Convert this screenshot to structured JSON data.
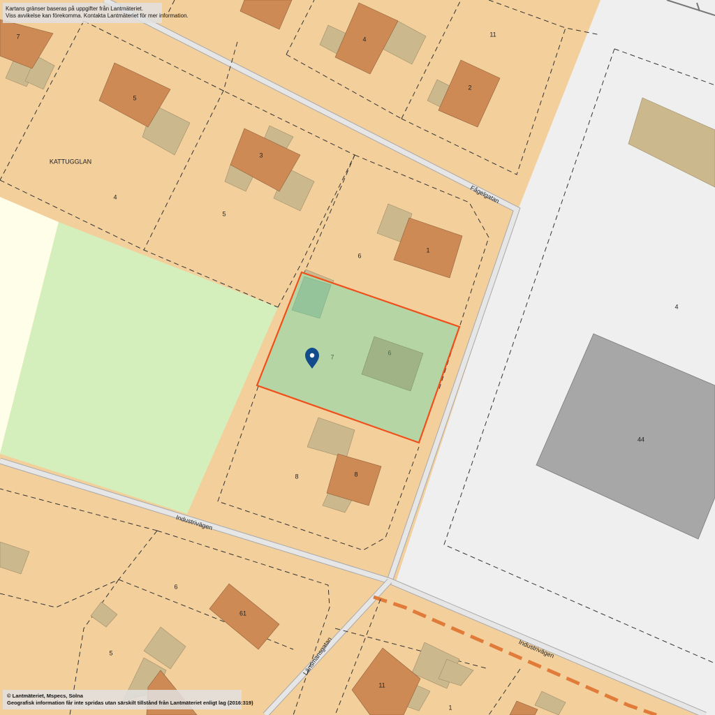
{
  "notice": {
    "line1": "Kartans gränser baseras på uppgifter från Lantmäteriet.",
    "line2": "Viss avvikelse kan förekomma. Kontakta Lantmäteriet för mer information."
  },
  "copyright": {
    "line1": "© Lantmäteriet, Mspecs, Solna",
    "line2": "Geografisk information får inte spridas utan särskilt tillstånd från Lantmäteriet enligt lag (2016:319)"
  },
  "streets": {
    "fagelgatan": "Fågelgatan",
    "industrivagen_west": "Industrivägen",
    "industrivagen_east": "Industrivägen",
    "lansmansgatan": "Länsmansgatan"
  },
  "areas": {
    "kattugglan": "KATTUGGLAN"
  },
  "labels": {
    "parcel_7_top": "7",
    "house_5": "5",
    "house_3": "3",
    "house_4": "4",
    "house_2": "2",
    "parcel_11_top": "11",
    "parcel_4_left": "4",
    "parcel_5_mid": "5",
    "parcel_6": "6",
    "house_1": "1",
    "selected_parcel": "7",
    "selected_building": "6",
    "parcel_8": "8",
    "house_8": "8",
    "parcel_4_right": "4",
    "building_44": "44",
    "parcel_6_bottom": "6",
    "house_61": "61",
    "parcel_5_bottom": "5",
    "house_11_bottom": "11",
    "parcel_1_bottom": "1"
  },
  "colors": {
    "land": "#f3cf9c",
    "house": "#cd8a54",
    "outbuilding": "#cbb98d",
    "road": "#d6d6d6",
    "industrial_area": "#efefef",
    "large_building": "#a7a7a7",
    "park": "#d4efbb",
    "open_field": "#fffee8",
    "selected_fill": "#b1d6a6",
    "selected_border": "#ef4f1b",
    "marker": "#124c8c",
    "orange_route": "#e07b39"
  },
  "icons": {
    "marker": "location-pin-icon"
  }
}
